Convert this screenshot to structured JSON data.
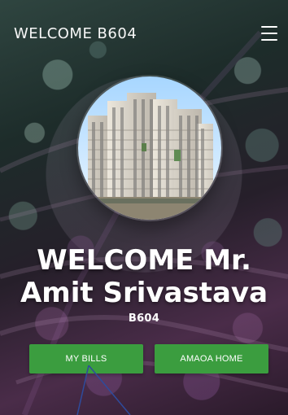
{
  "header": {
    "title": "WELCOME B604",
    "menu_icon": "hamburger-icon"
  },
  "hero": {
    "image_icon": "building-photo",
    "greeting_line1": "WELCOME Mr.",
    "greeting_line2": "Amit Srivastava",
    "unit": "B604"
  },
  "actions": {
    "left_label": "MY BILLS",
    "right_label": "AMAOA HOME"
  },
  "theme": {
    "button_color": "#3b9d3f",
    "text_color": "#ffffff"
  }
}
